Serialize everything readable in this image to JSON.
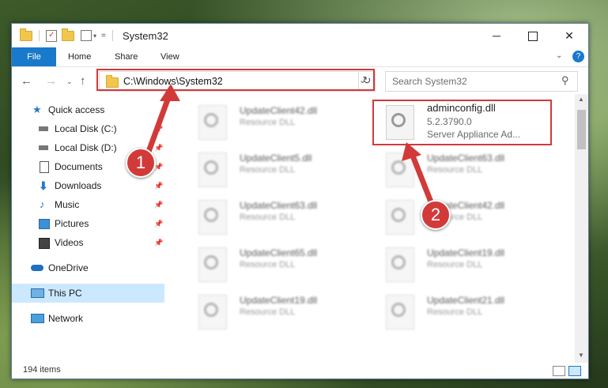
{
  "window": {
    "title": "System32",
    "minimize_icon": "minimize-icon",
    "maximize_icon": "maximize-icon",
    "close_icon": "close-icon"
  },
  "ribbon": {
    "tabs": [
      "File",
      "Home",
      "Share",
      "View"
    ]
  },
  "nav": {
    "address": "C:\\Windows\\System32",
    "search_placeholder": "Search System32"
  },
  "sidebar": {
    "items": [
      {
        "label": "Quick access",
        "icon": "star-icon",
        "pinned": false
      },
      {
        "label": "Local Disk (C:)",
        "icon": "drive-icon",
        "pinned": true
      },
      {
        "label": "Local Disk (D:)",
        "icon": "drive-icon",
        "pinned": true
      },
      {
        "label": "Documents",
        "icon": "documents-icon",
        "pinned": true
      },
      {
        "label": "Downloads",
        "icon": "downloads-icon",
        "pinned": true
      },
      {
        "label": "Music",
        "icon": "music-icon",
        "pinned": true
      },
      {
        "label": "Pictures",
        "icon": "pictures-icon",
        "pinned": true
      },
      {
        "label": "Videos",
        "icon": "videos-icon",
        "pinned": true
      },
      {
        "label": "OneDrive",
        "icon": "cloud-icon",
        "pinned": false
      },
      {
        "label": "This PC",
        "icon": "pc-icon",
        "pinned": false,
        "selected": true
      },
      {
        "label": "Network",
        "icon": "network-icon",
        "pinned": false
      }
    ]
  },
  "files": {
    "left": [
      {
        "name": "UpdateClient42.dll",
        "desc": "Resource DLL"
      },
      {
        "name": "UpdateClient5.dll",
        "desc": "Resource DLL"
      },
      {
        "name": "UpdateClient63.dll",
        "desc": "Resource DLL"
      },
      {
        "name": "UpdateClient65.dll",
        "desc": "Resource DLL"
      },
      {
        "name": "UpdateClient19.dll",
        "desc": "Resource DLL"
      }
    ],
    "right": [
      {
        "name": "adminconfig.dll",
        "version": "5.2.3790.0",
        "desc": "Server Appliance Ad..."
      },
      {
        "name": "UpdateClient63.dll",
        "desc": "Resource DLL"
      },
      {
        "name": "UpdateClient42.dll",
        "desc": "Resource DLL"
      },
      {
        "name": "UpdateClient19.dll",
        "desc": "Resource DLL"
      },
      {
        "name": "UpdateClient21.dll",
        "desc": "Resource DLL"
      }
    ]
  },
  "status": {
    "item_count": "194 items"
  },
  "callouts": [
    "1",
    "2"
  ],
  "colors": {
    "accent": "#1979ca",
    "highlight": "#d23a3a",
    "selected": "#cce8ff"
  }
}
